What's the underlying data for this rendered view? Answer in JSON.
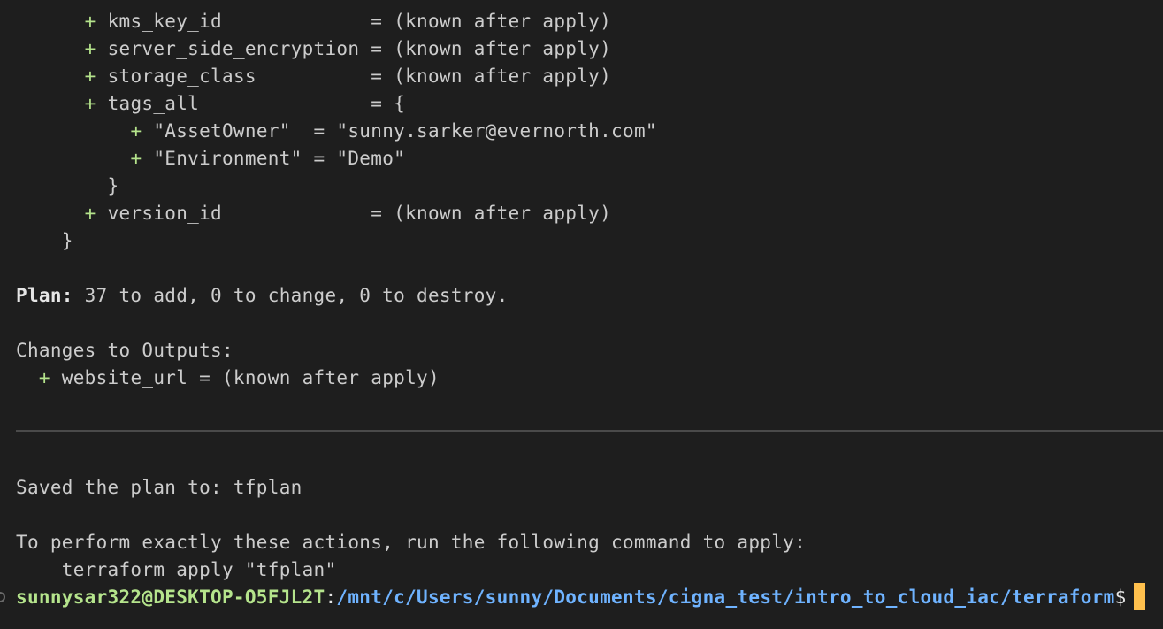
{
  "plan_attrs": [
    {
      "indent": "      ",
      "plus": "+",
      "text": " kms_key_id             = (known after apply)"
    },
    {
      "indent": "      ",
      "plus": "+",
      "text": " server_side_encryption = (known after apply)"
    },
    {
      "indent": "      ",
      "plus": "+",
      "text": " storage_class          = (known after apply)"
    },
    {
      "indent": "      ",
      "plus": "+",
      "text": " tags_all               = {"
    },
    {
      "indent": "          ",
      "plus": "+",
      "text": " \"AssetOwner\"  = \"sunny.sarker@evernorth.com\""
    },
    {
      "indent": "          ",
      "plus": "+",
      "text": " \"Environment\" = \"Demo\""
    },
    {
      "indent": "",
      "plus": "",
      "text": "        }"
    },
    {
      "indent": "      ",
      "plus": "+",
      "text": " version_id             = (known after apply)"
    },
    {
      "indent": "",
      "plus": "",
      "text": "    }"
    }
  ],
  "plan_summary": {
    "label": "Plan:",
    "text": " 37 to add, 0 to change, 0 to destroy."
  },
  "outputs": {
    "header": "Changes to Outputs:",
    "indent": "  ",
    "plus": "+",
    "text": " website_url = (known after apply)"
  },
  "saved": "Saved the plan to: tfplan",
  "apply_hint": "To perform exactly these actions, run the following command to apply:",
  "apply_command": "    terraform apply \"tfplan\"",
  "prompt": {
    "user_host": "sunnysar322@DESKTOP-O5FJL2T",
    "separator": ":",
    "path": "/mnt/c/Users/sunny/Documents/cigna_test/intro_to_cloud_iac/terraform",
    "sign": "$"
  },
  "colors": {
    "background": "#1e1e1e",
    "text": "#cccccc",
    "plus_sign": "#b5e48c",
    "prompt_user": "#b5e48c",
    "prompt_path": "#6fb3ff",
    "cursor": "#ffc04d"
  }
}
